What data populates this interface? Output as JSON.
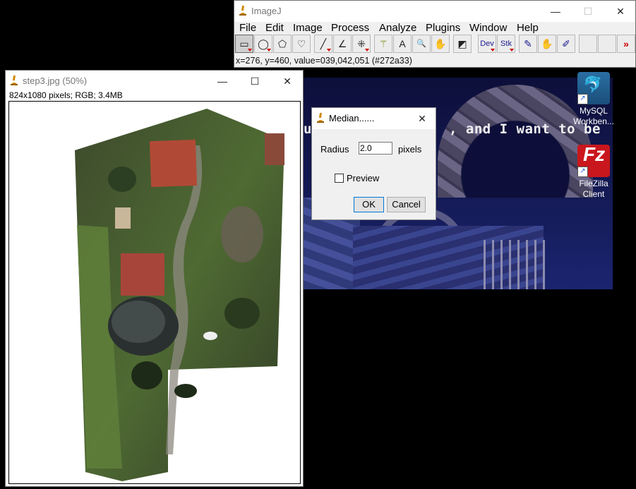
{
  "desktop": {
    "scene_caption_left": "u",
    "scene_caption_right": ", and I want to be",
    "icons": [
      {
        "label_line1": "MySQL",
        "label_line2": "Workben...",
        "icon": "mysql-workbench-icon"
      },
      {
        "label_line1": "FileZilla",
        "label_line2": "Client",
        "icon": "filezilla-icon"
      }
    ]
  },
  "imagej": {
    "title": "ImageJ",
    "menu": [
      "File",
      "Edit",
      "Image",
      "Process",
      "Analyze",
      "Plugins",
      "Window",
      "Help"
    ],
    "tools": [
      {
        "icon": "rectangle-tool-icon",
        "glyph": "▭"
      },
      {
        "icon": "oval-tool-icon",
        "glyph": "◯"
      },
      {
        "icon": "polygon-tool-icon",
        "glyph": "⬠"
      },
      {
        "icon": "freehand-tool-icon",
        "glyph": "♡"
      },
      {
        "icon": "line-tool-icon",
        "glyph": "╱"
      },
      {
        "icon": "angle-tool-icon",
        "glyph": "∠"
      },
      {
        "icon": "point-tool-icon",
        "glyph": "⁜"
      },
      {
        "icon": "wand-tool-icon",
        "glyph": "⚚"
      },
      {
        "icon": "text-tool-icon",
        "glyph": "A"
      },
      {
        "icon": "magnifier-tool-icon",
        "glyph": "🔍"
      },
      {
        "icon": "hand-tool-icon",
        "glyph": "✋"
      },
      {
        "icon": "color-picker-tool-icon",
        "glyph": "◩"
      },
      {
        "icon": "developer-menu-icon",
        "glyph": "Dev"
      },
      {
        "icon": "stack-menu-icon",
        "glyph": "Stk"
      },
      {
        "icon": "brush-tool-icon",
        "glyph": "✎"
      },
      {
        "icon": "flood-fill-tool-icon",
        "glyph": "✋"
      },
      {
        "icon": "pencil-tool-icon",
        "glyph": "✐"
      },
      {
        "icon": "more-tools-icon",
        "glyph": "»"
      }
    ],
    "status": "x=276, y=460, value=039,042,051 (#272a33)"
  },
  "image_window": {
    "title": "step3.jpg (50%)",
    "info": "824x1080 pixels; RGB; 3.4MB"
  },
  "median_dialog": {
    "title": "Median......",
    "radius_label": "Radius",
    "radius_value": "2.0",
    "units": "pixels",
    "preview_label": "Preview",
    "preview_checked": false,
    "ok_label": "OK",
    "cancel_label": "Cancel"
  },
  "window_buttons": {
    "minimize": "—",
    "maximize": "☐",
    "close": "✕"
  }
}
